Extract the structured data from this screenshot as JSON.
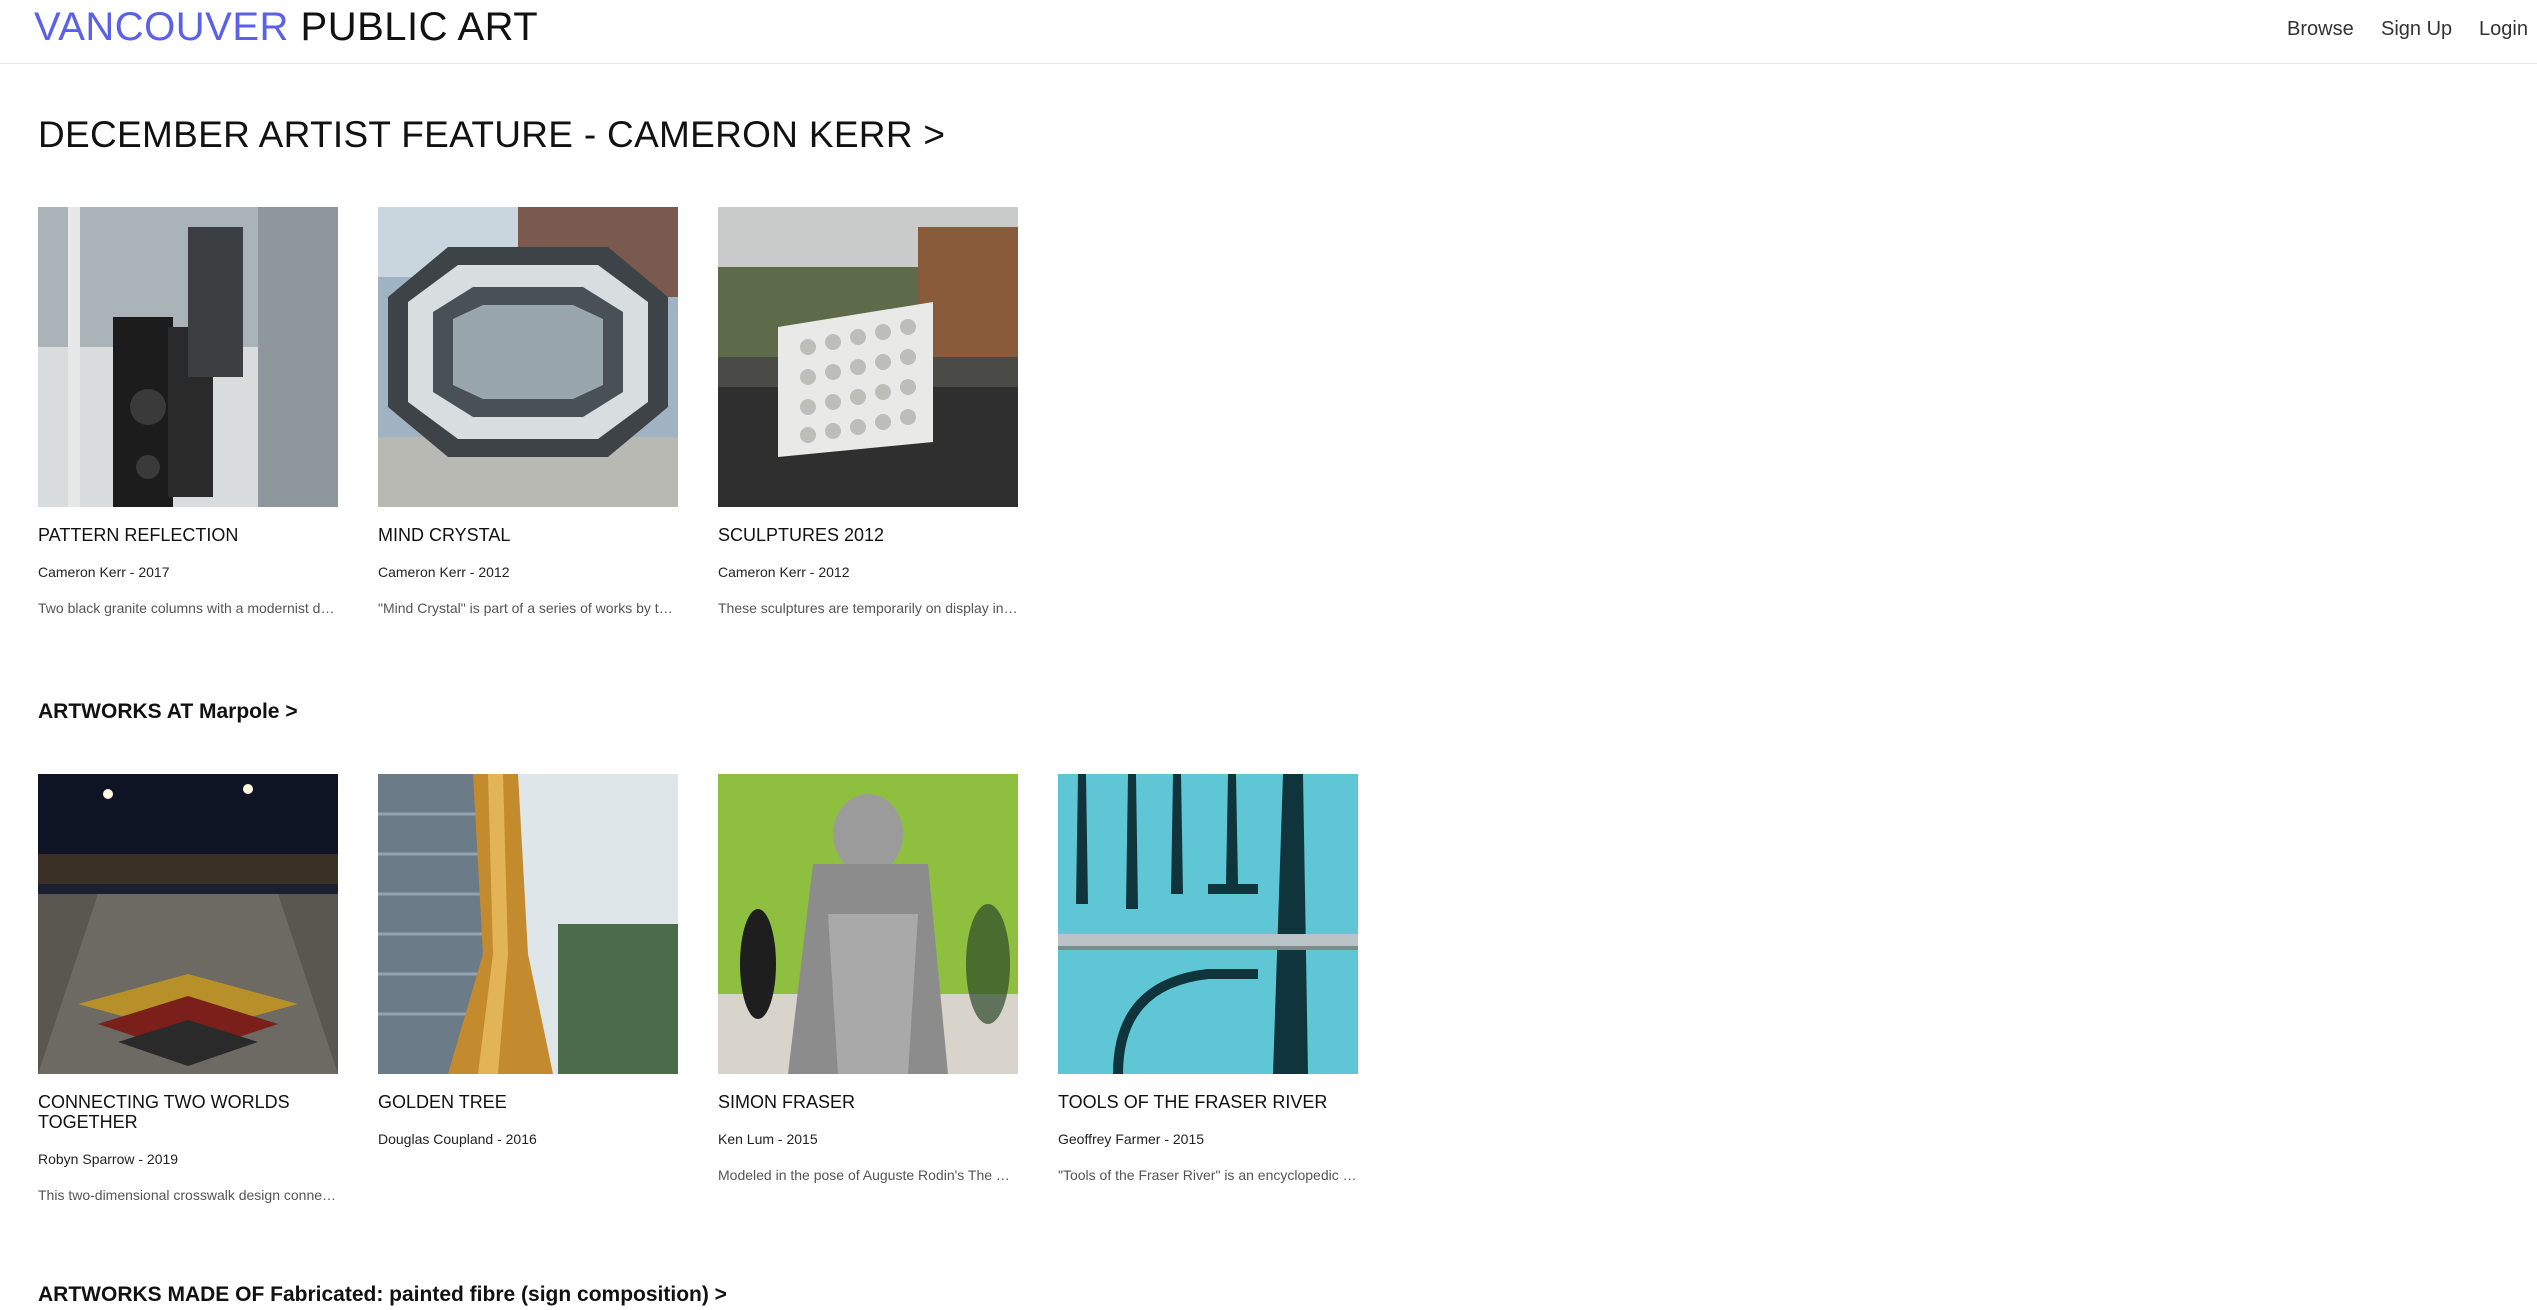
{
  "header": {
    "brand_accent": "VANCOUVER",
    "brand_rest": "PUBLIC ART",
    "brand_color": "#5a60e8",
    "nav": [
      "Browse",
      "Sign Up",
      "Login"
    ]
  },
  "sections": [
    {
      "title": "DECEMBER ARTIST FEATURE - CAMERON KERR >",
      "cards": [
        {
          "title": "PATTERN REFLECTION",
          "meta": "Cameron Kerr - 2017",
          "desc": "Two black granite columns with a modernist design cut into them..."
        },
        {
          "title": "MIND CRYSTAL",
          "meta": "Cameron Kerr - 2012",
          "desc": "\"Mind Crystal\" is part of a series of works by the artist..."
        },
        {
          "title": "SCULPTURES 2012",
          "meta": "Cameron Kerr - 2012",
          "desc": "These sculptures are temporarily on display in the park..."
        }
      ]
    },
    {
      "title": "ARTWORKS AT Marpole >",
      "cards": [
        {
          "title": "CONNECTING TWO WORLDS TOGETHER",
          "meta": "Robyn Sparrow - 2019",
          "desc": "This two-dimensional crosswalk design connects the neighbourhood..."
        },
        {
          "title": "GOLDEN TREE",
          "meta": "Douglas Coupland - 2016",
          "desc": ""
        },
        {
          "title": "SIMON FRASER",
          "meta": "Ken Lum - 2015",
          "desc": "Modeled in the pose of Auguste Rodin's The Thinker..."
        },
        {
          "title": "TOOLS OF THE FRASER RIVER",
          "meta": "Geoffrey Farmer - 2015",
          "desc": "\"Tools of the Fraser River\" is an encyclopedic work..."
        }
      ]
    },
    {
      "title": "ARTWORKS MADE OF Fabricated: painted fibre (sign composition) >"
    }
  ]
}
